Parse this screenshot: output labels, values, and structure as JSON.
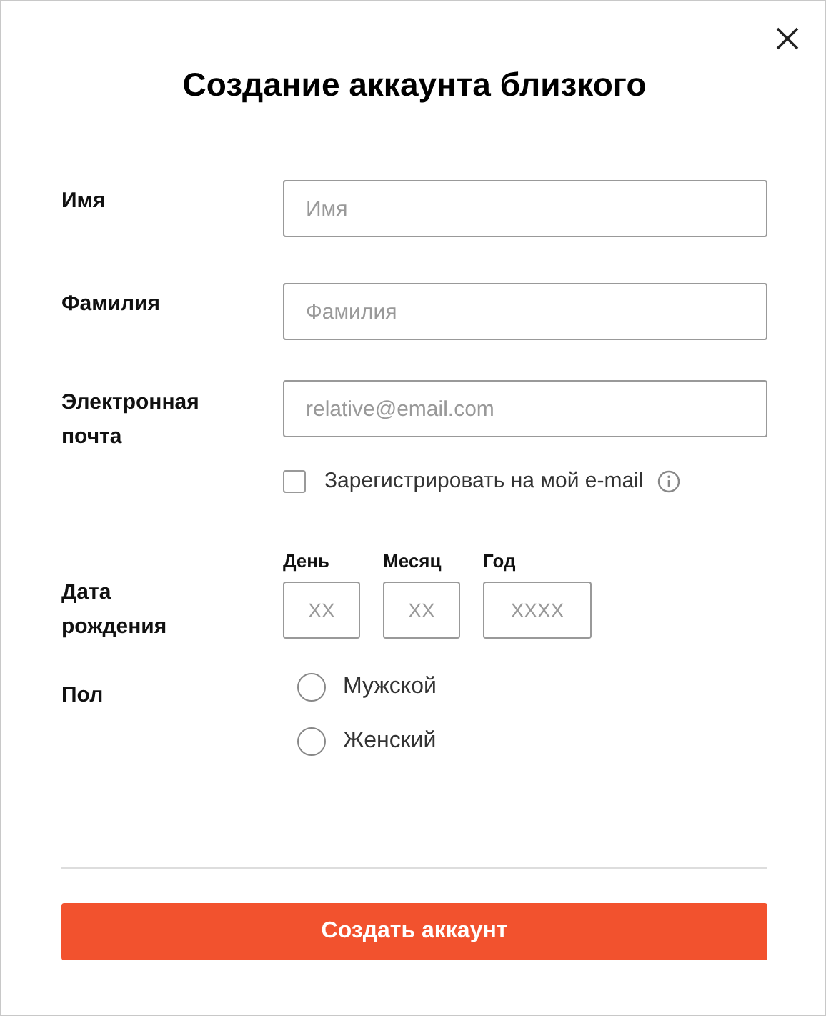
{
  "dialog": {
    "title": "Создание аккаунта близкого"
  },
  "fields": [
    {
      "kind": "text",
      "label": "Имя",
      "placeholder": "Имя"
    },
    {
      "kind": "text",
      "label": "Фамилия",
      "placeholder": "Фамилия"
    },
    {
      "kind": "email",
      "label": "Электронная почта",
      "placeholder": "relative@email.com",
      "option": {
        "label": "Зарегистрировать на мой e-mail",
        "checked": false
      }
    },
    {
      "kind": "date",
      "label": "Дата рождения",
      "parts": [
        {
          "label": "День",
          "placeholder": "XX"
        },
        {
          "label": "Месяц",
          "placeholder": "XX"
        },
        {
          "label": "Год",
          "placeholder": "XXXX"
        }
      ]
    },
    {
      "kind": "radio",
      "label": "Пол",
      "options": [
        {
          "label": "Мужской",
          "selected": false
        },
        {
          "label": "Женский",
          "selected": false
        }
      ]
    }
  ],
  "submit": "Создать аккаунт"
}
